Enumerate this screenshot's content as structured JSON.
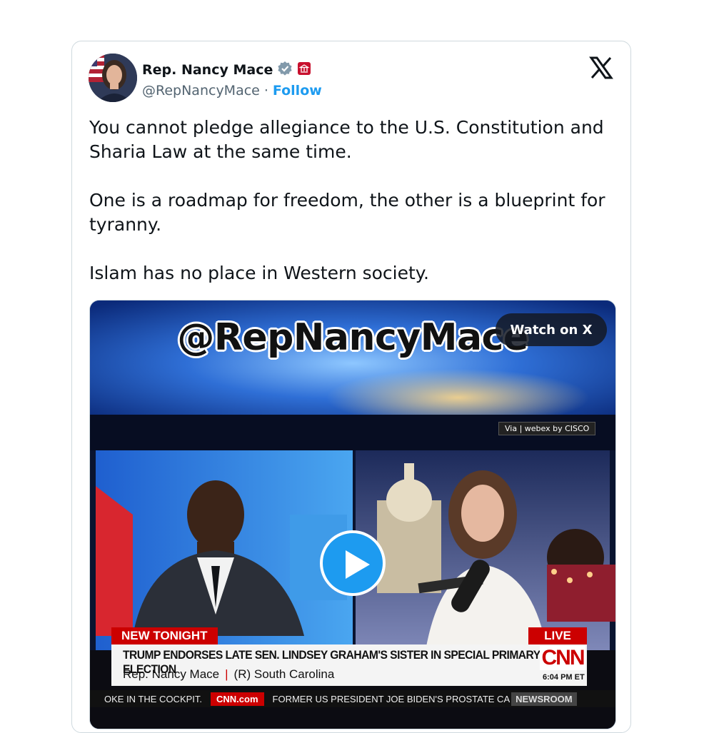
{
  "author": {
    "name": "Rep. Nancy Mace",
    "handle": "@RepNancyMace",
    "separator": "·",
    "follow_label": "Follow",
    "verified_icon": "verified-badge-icon",
    "affiliation_icon": "government-building-icon"
  },
  "tweet": {
    "paragraphs": [
      "You cannot pledge allegiance to the U.S. Constitution and Sharia Law at the same time.",
      "One is a roadmap for freedom, the other is a blueprint for tyranny.",
      "Islam has no place in Western society."
    ]
  },
  "media": {
    "watch_label": "Watch on X",
    "banner_handle": "@RepNancyMace",
    "via_badge": "Via | webex by CISCO",
    "new_tonight": "NEW TONIGHT",
    "live": "LIVE",
    "headline": "TRUMP ENDORSES LATE SEN. LINDSEY GRAHAM'S SISTER IN SPECIAL PRIMARY ELECTION",
    "subline_name": "Rep. Nancy Mace",
    "subline_sep": "|",
    "subline_party": "(R) South Carolina",
    "network_logo": "CNN",
    "time": "6:04 PM ET",
    "ticker_left": "OKE IN THE COCKPIT.",
    "ticker_site": "CNN.com",
    "ticker_right": "FORMER US PRESIDENT JOE BIDEN'S PROSTATE CA",
    "ticker_show": "NEWSROOM"
  },
  "colors": {
    "accent": "#1d9bf0",
    "cnn_red": "#cc0000"
  }
}
